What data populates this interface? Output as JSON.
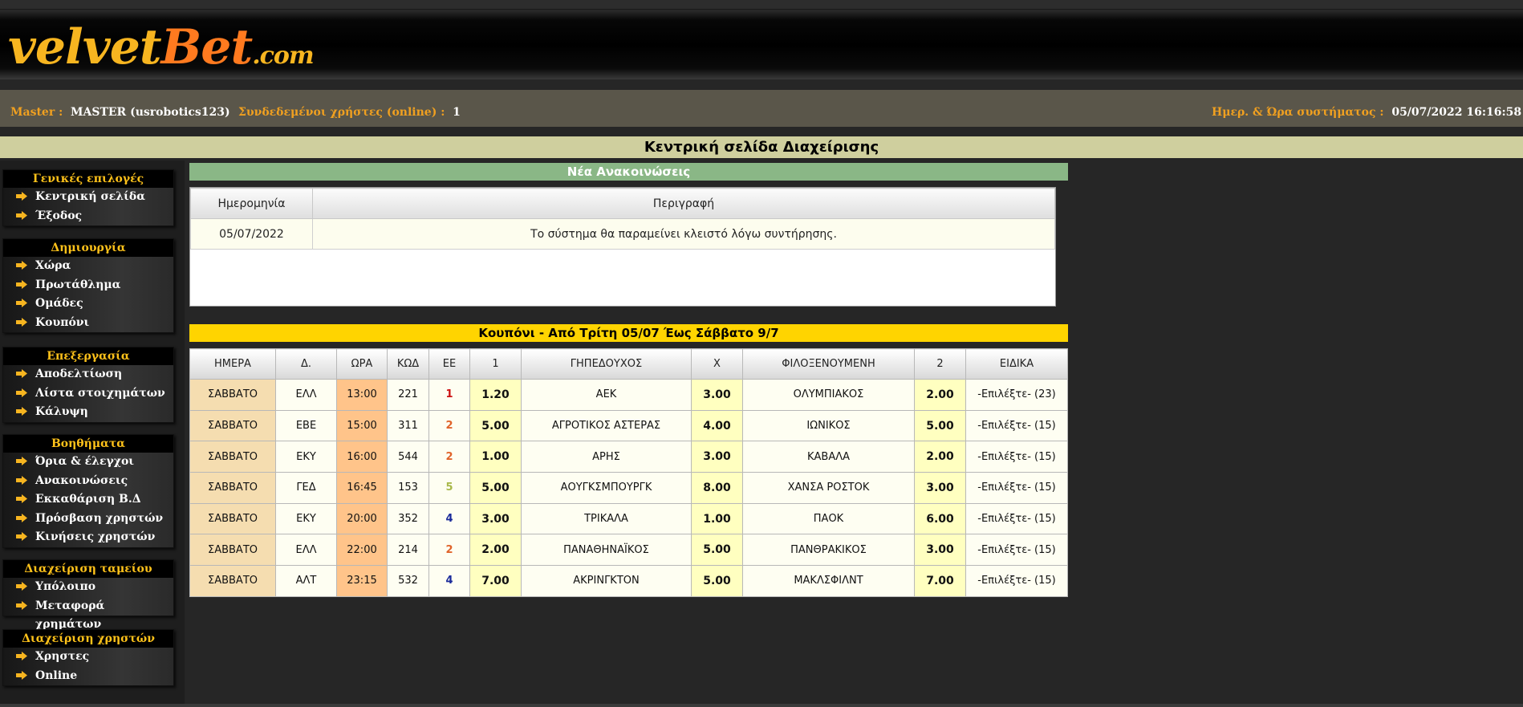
{
  "logo": {
    "part1": "velvet",
    "part2": "Bet",
    "part3": ".com"
  },
  "info": {
    "master_label": "Master :",
    "master_value": "MASTER (usrobotics123)",
    "online_label": "Συνδεδεμένοι χρήστες (online) :",
    "online_value": "1",
    "datetime_label": "Ημερ. & Ώρα συστήματος :",
    "datetime_value": "05/07/2022 16:16:58"
  },
  "page_title": "Κεντρική σελίδα Διαχείρισης",
  "sidebar": {
    "general": {
      "title": "Γενικές επιλογές",
      "items": [
        "Κεντρική σελίδα",
        "Έξοδος"
      ]
    },
    "create": {
      "title": "Δημιουργία",
      "items": [
        "Χώρα",
        "Πρωτάθλημα",
        "Ομάδες",
        "Κουπόνι"
      ]
    },
    "edit": {
      "title": "Επεξεργασία",
      "items": [
        "Αποδελτίωση",
        "Λίστα στοιχημάτων",
        "Κάλυψη"
      ]
    },
    "helpers": {
      "title": "Βοηθήματα",
      "items": [
        "Όρια & έλεγχοι",
        "Ανακοινώσεις",
        "Εκκαθάριση Β.Δ",
        "Πρόσβαση χρηστών",
        "Κινήσεις χρηστών"
      ]
    },
    "cash": {
      "title": "Διαχείριση ταμείου",
      "items": [
        "Υπόλοιπο",
        "Μεταφορά χρημάτων"
      ]
    },
    "users": {
      "title": "Διαχείριση χρηστών",
      "items": [
        "Χρηστες",
        "Online"
      ]
    }
  },
  "announcements": {
    "title": "Νέα Ανακοινώσεις",
    "headers": [
      "Ημερομηνία",
      "Περιγραφή"
    ],
    "rows": [
      [
        "05/07/2022",
        "Το σύστημα θα παραμείνει κλειστό λόγω συντήρησης."
      ]
    ]
  },
  "coupon": {
    "title": "Κουπόνι - Από Τρίτη 05/07 Έως Σάββατο 9/7",
    "headers": [
      "ΗΜΕΡΑ",
      "Δ.",
      "ΩΡΑ",
      "ΚΩΔ",
      "ΕΕ",
      "1",
      "ΓΗΠΕΔΟΥΧΟΣ",
      "Χ",
      "ΦΙΛΟΞΕΝΟΥΜΕΝΗ",
      "2",
      "ΕΙΔΙΚΑ"
    ],
    "rows": [
      [
        "ΣΑΒΒΑΤΟ",
        "ΕΛΛ",
        "13:00",
        "221",
        "1",
        "1.20",
        "ΑΕΚ",
        "3.00",
        "ΟΛΥΜΠΙΑΚΟΣ",
        "2.00",
        "-Επιλέξτε- (23)"
      ],
      [
        "ΣΑΒΒΑΤΟ",
        "ΕΒΕ",
        "15:00",
        "311",
        "2",
        "5.00",
        "ΑΓΡΟΤΙΚΟΣ ΑΣΤΕΡΑΣ",
        "4.00",
        "ΙΩΝΙΚΟΣ",
        "5.00",
        "-Επιλέξτε- (15)"
      ],
      [
        "ΣΑΒΒΑΤΟ",
        "ΕΚΥ",
        "16:00",
        "544",
        "2",
        "1.00",
        "ΑΡΗΣ",
        "3.00",
        "ΚΑΒΑΛΑ",
        "2.00",
        "-Επιλέξτε- (15)"
      ],
      [
        "ΣΑΒΒΑΤΟ",
        "ΓΕΔ",
        "16:45",
        "153",
        "5",
        "5.00",
        "ΑΟΥΓΚΣΜΠΟΥΡΓΚ",
        "8.00",
        "ΧΑΝΣΑ ΡΟΣΤΟΚ",
        "3.00",
        "-Επιλέξτε- (15)"
      ],
      [
        "ΣΑΒΒΑΤΟ",
        "ΕΚΥ",
        "20:00",
        "352",
        "4",
        "3.00",
        "ΤΡΙΚΑΛΑ",
        "1.00",
        "ΠΑΟΚ",
        "6.00",
        "-Επιλέξτε- (15)"
      ],
      [
        "ΣΑΒΒΑΤΟ",
        "ΕΛΛ",
        "22:00",
        "214",
        "2",
        "2.00",
        "ΠΑΝΑΘΗΝΑΪΚΟΣ",
        "5.00",
        "ΠΑΝΘΡΑΚΙΚΟΣ",
        "3.00",
        "-Επιλέξτε- (15)"
      ],
      [
        "ΣΑΒΒΑΤΟ",
        "ΑΛΤ",
        "23:15",
        "532",
        "4",
        "7.00",
        "ΑΚΡΙΝΓΚΤΟΝ",
        "5.00",
        "ΜΑΚΛΣΦΙΛΝΤ",
        "7.00",
        "-Επιλέξτε- (15)"
      ]
    ],
    "ee_colors": {
      "1": "#cc1111",
      "2": "#e0632a",
      "4": "#1a2a9a",
      "5": "#a8b84a"
    }
  },
  "colors": {
    "accent": "#ffc21a",
    "title_bar": "#cfcf9e",
    "ann_header": "#8ab786",
    "coupon_header": "#ffd400"
  }
}
